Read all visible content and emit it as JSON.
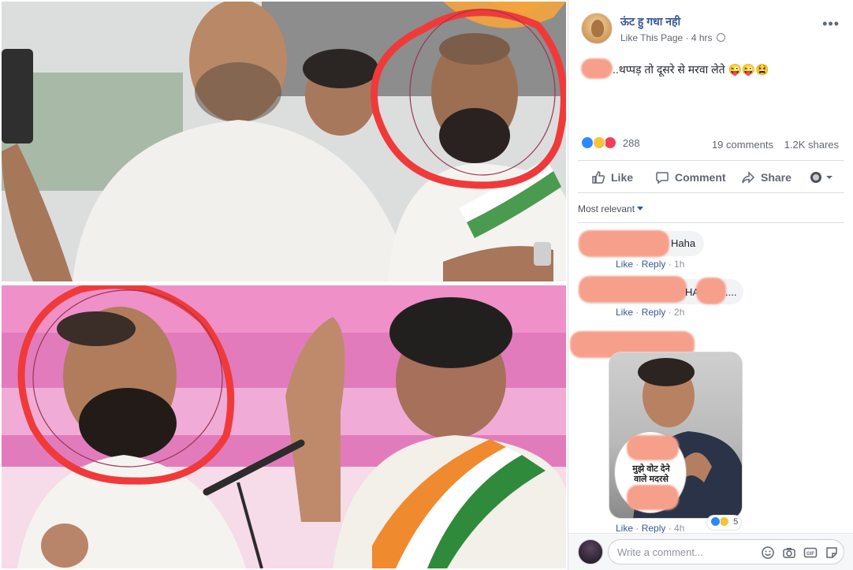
{
  "post": {
    "page_name": "ऊंट हु गधा नही",
    "like_page": "Like This Page",
    "time": "4 hrs",
    "separator": "·",
    "text": "..थप्पड़ तो दूसरे से मरवा लेते 😜😜😫",
    "reaction_count": "288",
    "comments_count": "19 comments",
    "shares_count": "1.2K shares"
  },
  "actions": {
    "like": "Like",
    "comment": "Comment",
    "share": "Share"
  },
  "sort": {
    "label": "Most relevant"
  },
  "comments": [
    {
      "text": "Haha",
      "like": "Like",
      "reply": "Reply",
      "time": "1h"
    },
    {
      "text": "HA",
      "ellipsis": "....",
      "like": "Like",
      "reply": "Reply",
      "time": "2h"
    },
    {
      "like": "Like",
      "reply": "Reply",
      "time": "4h",
      "meme_text": "मुझे वोट देने वाले मदरसे",
      "reaction_count": "5"
    }
  ],
  "composer": {
    "placeholder": "Write a comment..."
  },
  "icons": {
    "more": "more-options-icon",
    "globe": "globe-icon",
    "like": "thumbs-up-icon",
    "comment": "comment-bubble-icon",
    "share": "share-arrow-icon",
    "audience": "audience-selector-icon",
    "emoji": "emoji-icon",
    "camera": "camera-icon",
    "gif": "gif-icon",
    "sticker": "sticker-icon"
  },
  "colors": {
    "link": "#365899",
    "like_blue": "#2d88ff",
    "haha_yellow": "#f7c23b",
    "love_red": "#f33e58",
    "annotation_red": "#f03a3a",
    "redaction": "#f6a08c"
  }
}
